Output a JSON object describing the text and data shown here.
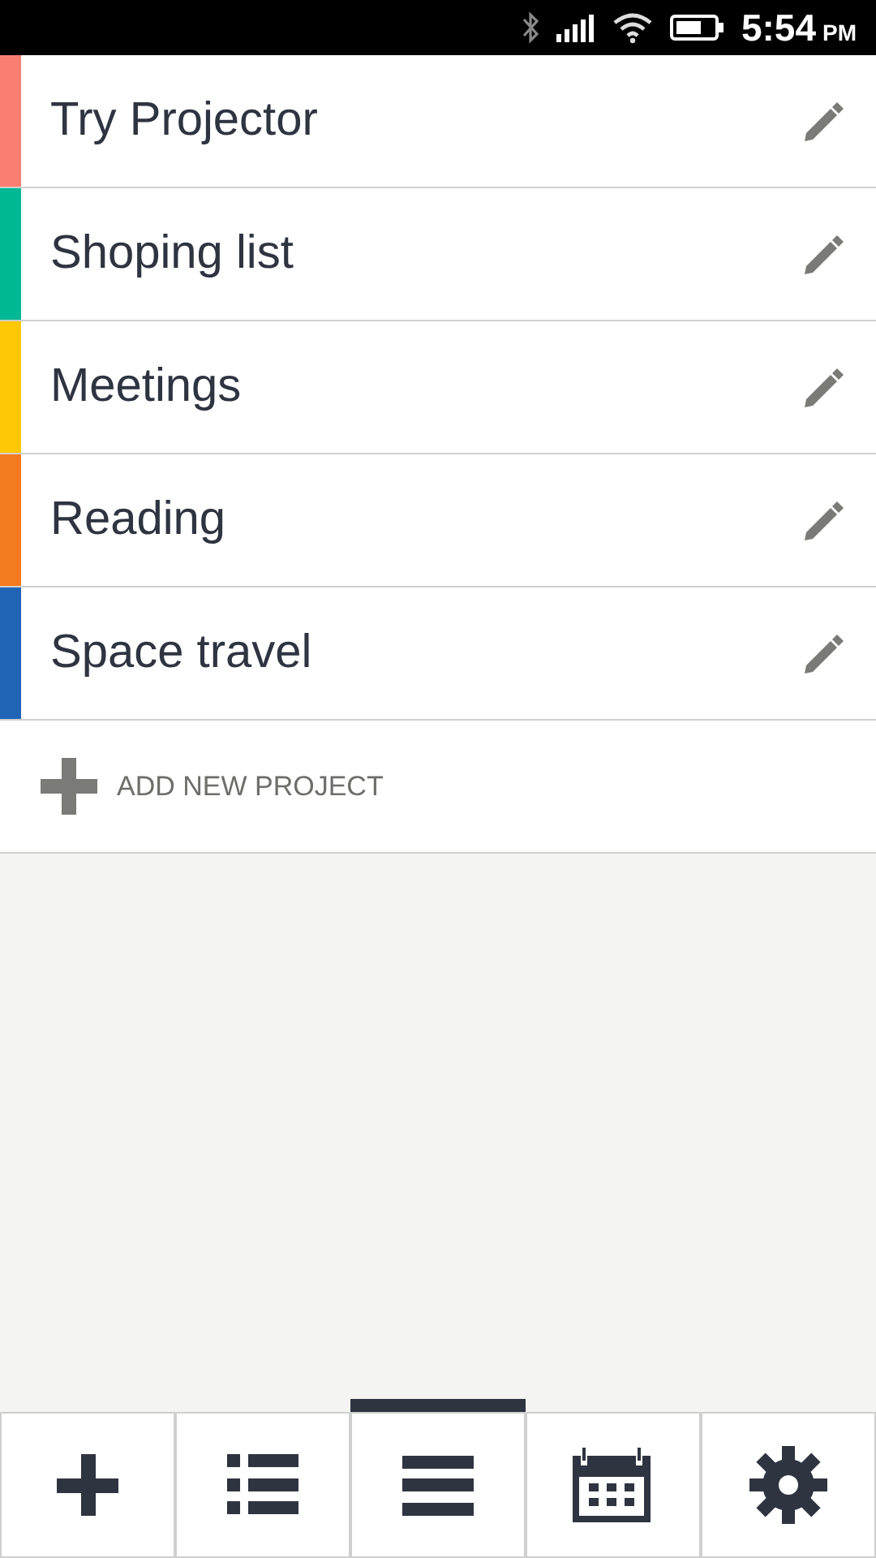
{
  "status_bar": {
    "time": "5:54",
    "ampm": "PM"
  },
  "projects": [
    {
      "name": "Try Projector",
      "color": "#fa7f72"
    },
    {
      "name": "Shoping list",
      "color": "#00b894"
    },
    {
      "name": "Meetings",
      "color": "#ffc807"
    },
    {
      "name": "Reading",
      "color": "#f47a20"
    },
    {
      "name": "Space travel",
      "color": "#2064b5"
    }
  ],
  "add_project": {
    "label": "ADD NEW PROJECT"
  },
  "tabs": [
    {
      "kind": "add",
      "selected": false
    },
    {
      "kind": "list",
      "selected": false
    },
    {
      "kind": "menu",
      "selected": true
    },
    {
      "kind": "calendar",
      "selected": false
    },
    {
      "kind": "settings",
      "selected": false
    }
  ]
}
